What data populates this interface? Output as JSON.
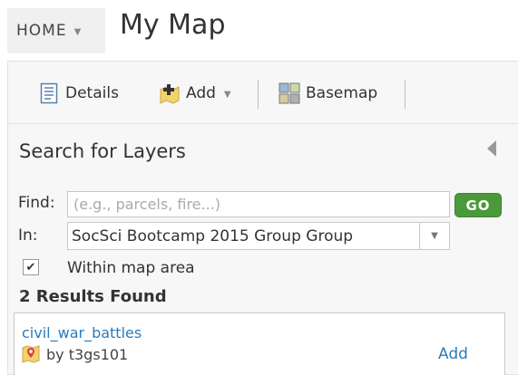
{
  "header": {
    "home_label": "HOME",
    "title": "My Map"
  },
  "toolbar": {
    "details_label": "Details",
    "add_label": "Add",
    "basemap_label": "Basemap"
  },
  "search_panel": {
    "title": "Search for Layers",
    "find_label": "Find:",
    "find_placeholder": "(e.g., parcels, fire...)",
    "find_value": "",
    "go_label": "GO",
    "in_label": "In:",
    "in_selected": "SocSci Bootcamp 2015 Group Group",
    "within_map_checked": true,
    "within_map_label": "Within map area",
    "results_count_label": "2 Results Found",
    "results": [
      {
        "name": "civil_war_battles",
        "owner": "by t3gs101",
        "action_label": "Add"
      }
    ]
  },
  "colors": {
    "accent_green": "#4a9a3a",
    "link_blue": "#2b7bb9",
    "panel_bg": "#f7f7f7"
  }
}
